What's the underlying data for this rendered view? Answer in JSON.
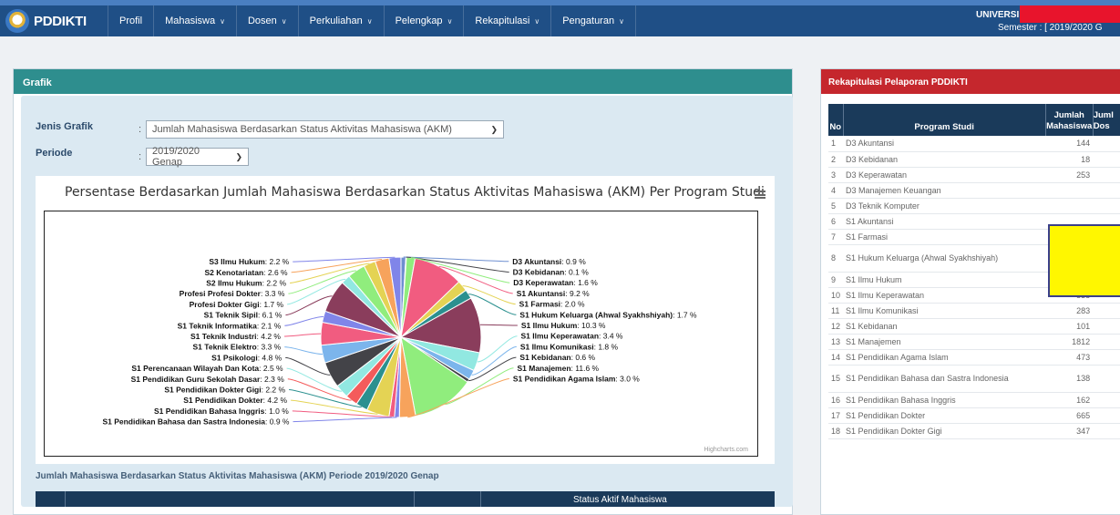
{
  "navbar": {
    "brand": "PDDIKTI",
    "items": [
      {
        "label": "Profil",
        "caret": false
      },
      {
        "label": "Mahasiswa",
        "caret": true
      },
      {
        "label": "Dosen",
        "caret": true
      },
      {
        "label": "Perkuliahan",
        "caret": true
      },
      {
        "label": "Pelengkap",
        "caret": true
      },
      {
        "label": "Rekapitulasi",
        "caret": true
      },
      {
        "label": "Pengaturan",
        "caret": true
      }
    ],
    "university_label": "UNIVERSI",
    "semester_label": "Semester : [ 2019/2020 G"
  },
  "grafik": {
    "panel_title": "Grafik",
    "jenis_label": "Jenis Grafik",
    "jenis_value": "Jumlah Mahasiswa Berdasarkan Status Aktivitas Mahasiswa (AKM)",
    "periode_label": "Periode",
    "periode_value": "2019/2020 Genap",
    "colon": ":",
    "table_subtitle": "Jumlah Mahasiswa Berdasarkan Status Aktivitas Mahasiswa (AKM) Periode 2019/2020 Genap",
    "table_header": "Status Aktif Mahasiswa"
  },
  "chart_data": {
    "type": "pie",
    "title": "Persentase Berdasarkan Jumlah Mahasiswa Berdasarkan Status Aktivitas Mahasiswa (AKM) Per Program Studi",
    "credit": "Highcharts.com",
    "unit": "%",
    "series": [
      {
        "name": "D3 Akuntansi",
        "value": 0.9,
        "color": "#6e8fd0"
      },
      {
        "name": "D3 Kebidanan",
        "value": 0.1,
        "color": "#434348"
      },
      {
        "name": "D3 Keperawatan",
        "value": 1.6,
        "color": "#90ed7d"
      },
      {
        "name": "S1 Akuntansi",
        "value": 9.2,
        "color": "#f15c80"
      },
      {
        "name": "S1 Farmasi",
        "value": 2.0,
        "color": "#e4d354"
      },
      {
        "name": "S1 Hukum Keluarga (Ahwal Syakhshiyah)",
        "value": 1.7,
        "color": "#2b908f"
      },
      {
        "name": "S1 Ilmu Hukum",
        "value": 10.3,
        "color": "#8a3d5c"
      },
      {
        "name": "S1 Ilmu Keperawatan",
        "value": 3.4,
        "color": "#91e8e1"
      },
      {
        "name": "S1 Ilmu Komunikasi",
        "value": 1.8,
        "color": "#7cb5ec"
      },
      {
        "name": "S1 Kebidanan",
        "value": 0.6,
        "color": "#434348"
      },
      {
        "name": "S1 Manajemen",
        "value": 11.6,
        "color": "#90ed7d"
      },
      {
        "name": "S1 Pendidikan Agama Islam",
        "value": 3.0,
        "color": "#f7a35c"
      },
      {
        "name": "S1 Pendidikan Bahasa dan Sastra Indonesia",
        "value": 0.9,
        "color": "#8085e9"
      },
      {
        "name": "S1 Pendidikan Bahasa Inggris",
        "value": 1.0,
        "color": "#f15c80"
      },
      {
        "name": "S1 Pendidikan Dokter",
        "value": 4.2,
        "color": "#e4d354"
      },
      {
        "name": "S1 Pendidikan Dokter Gigi",
        "value": 2.2,
        "color": "#2b908f"
      },
      {
        "name": "S1 Pendidikan Guru Sekolah Dasar",
        "value": 2.3,
        "color": "#f45b5b"
      },
      {
        "name": "S1 Perencanaan Wilayah Dan Kota",
        "value": 2.5,
        "color": "#91e8e1"
      },
      {
        "name": "S1 Psikologi",
        "value": 4.8,
        "color": "#434348"
      },
      {
        "name": "S1 Teknik Elektro",
        "value": 3.3,
        "color": "#7cb5ec"
      },
      {
        "name": "S1 Teknik Industri",
        "value": 4.2,
        "color": "#f15c80"
      },
      {
        "name": "S1 Teknik Informatika",
        "value": 2.1,
        "color": "#8085e9"
      },
      {
        "name": "S1 Teknik Sipil",
        "value": 6.1,
        "color": "#8a3d5c"
      },
      {
        "name": "Profesi Dokter Gigi",
        "value": 1.7,
        "color": "#91e8e1"
      },
      {
        "name": "Profesi Profesi Dokter",
        "value": 3.3,
        "color": "#90ed7d"
      },
      {
        "name": "S2 Ilmu Hukum",
        "value": 2.2,
        "color": "#e4d354"
      },
      {
        "name": "S2 Kenotariatan",
        "value": 2.6,
        "color": "#f7a35c"
      },
      {
        "name": "S3 Ilmu Hukum",
        "value": 2.2,
        "color": "#8085e9"
      }
    ]
  },
  "rekap": {
    "panel_title": "Rekapitulasi Pelaporan PDDIKTI",
    "columns": {
      "no": "No",
      "prodi": "Program Studi",
      "jumlah1": "Jumlah",
      "jumlah2": "Mahasiswa",
      "dosen1": "Juml",
      "dosen2": "Dos"
    },
    "rows": [
      {
        "no": "1",
        "prodi": "D3 Akuntansi",
        "jumlah": "144"
      },
      {
        "no": "2",
        "prodi": "D3 Kebidanan",
        "jumlah": "18"
      },
      {
        "no": "3",
        "prodi": "D3 Keperawatan",
        "jumlah": "253"
      },
      {
        "no": "4",
        "prodi": "D3 Manajemen Keuangan",
        "jumlah": ""
      },
      {
        "no": "5",
        "prodi": "D3 Teknik Komputer",
        "jumlah": ""
      },
      {
        "no": "6",
        "prodi": "S1 Akuntansi",
        "jumlah": ""
      },
      {
        "no": "7",
        "prodi": "S1 Farmasi",
        "jumlah": ""
      },
      {
        "no": "8",
        "prodi": "S1 Hukum Keluarga (Ahwal Syakhshiyah)",
        "jumlah": ""
      },
      {
        "no": "9",
        "prodi": "S1 Ilmu Hukum",
        "jumlah": "1615"
      },
      {
        "no": "10",
        "prodi": "S1 Ilmu Keperawatan",
        "jumlah": "538"
      },
      {
        "no": "11",
        "prodi": "S1 Ilmu Komunikasi",
        "jumlah": "283"
      },
      {
        "no": "12",
        "prodi": "S1 Kebidanan",
        "jumlah": "101"
      },
      {
        "no": "13",
        "prodi": "S1 Manajemen",
        "jumlah": "1812"
      },
      {
        "no": "14",
        "prodi": "S1 Pendidikan Agama Islam",
        "jumlah": "473"
      },
      {
        "no": "15",
        "prodi": "S1 Pendidikan Bahasa dan Sastra Indonesia",
        "jumlah": "138"
      },
      {
        "no": "16",
        "prodi": "S1 Pendidikan Bahasa Inggris",
        "jumlah": "162"
      },
      {
        "no": "17",
        "prodi": "S1 Pendidikan Dokter",
        "jumlah": "665"
      },
      {
        "no": "18",
        "prodi": "S1 Pendidikan Dokter Gigi",
        "jumlah": "347"
      }
    ]
  }
}
